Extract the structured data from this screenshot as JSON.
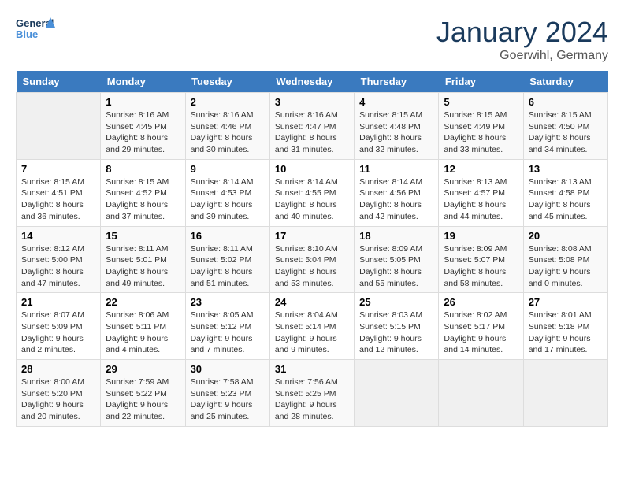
{
  "header": {
    "logo_line1": "General",
    "logo_line2": "Blue",
    "title": "January 2024",
    "subtitle": "Goerwihl, Germany"
  },
  "calendar": {
    "headers": [
      "Sunday",
      "Monday",
      "Tuesday",
      "Wednesday",
      "Thursday",
      "Friday",
      "Saturday"
    ],
    "weeks": [
      [
        {
          "day": "",
          "sunrise": "",
          "sunset": "",
          "daylight": "",
          "empty": true
        },
        {
          "day": "1",
          "sunrise": "Sunrise: 8:16 AM",
          "sunset": "Sunset: 4:45 PM",
          "daylight": "Daylight: 8 hours and 29 minutes."
        },
        {
          "day": "2",
          "sunrise": "Sunrise: 8:16 AM",
          "sunset": "Sunset: 4:46 PM",
          "daylight": "Daylight: 8 hours and 30 minutes."
        },
        {
          "day": "3",
          "sunrise": "Sunrise: 8:16 AM",
          "sunset": "Sunset: 4:47 PM",
          "daylight": "Daylight: 8 hours and 31 minutes."
        },
        {
          "day": "4",
          "sunrise": "Sunrise: 8:15 AM",
          "sunset": "Sunset: 4:48 PM",
          "daylight": "Daylight: 8 hours and 32 minutes."
        },
        {
          "day": "5",
          "sunrise": "Sunrise: 8:15 AM",
          "sunset": "Sunset: 4:49 PM",
          "daylight": "Daylight: 8 hours and 33 minutes."
        },
        {
          "day": "6",
          "sunrise": "Sunrise: 8:15 AM",
          "sunset": "Sunset: 4:50 PM",
          "daylight": "Daylight: 8 hours and 34 minutes."
        }
      ],
      [
        {
          "day": "7",
          "sunrise": "Sunrise: 8:15 AM",
          "sunset": "Sunset: 4:51 PM",
          "daylight": "Daylight: 8 hours and 36 minutes."
        },
        {
          "day": "8",
          "sunrise": "Sunrise: 8:15 AM",
          "sunset": "Sunset: 4:52 PM",
          "daylight": "Daylight: 8 hours and 37 minutes."
        },
        {
          "day": "9",
          "sunrise": "Sunrise: 8:14 AM",
          "sunset": "Sunset: 4:53 PM",
          "daylight": "Daylight: 8 hours and 39 minutes."
        },
        {
          "day": "10",
          "sunrise": "Sunrise: 8:14 AM",
          "sunset": "Sunset: 4:55 PM",
          "daylight": "Daylight: 8 hours and 40 minutes."
        },
        {
          "day": "11",
          "sunrise": "Sunrise: 8:14 AM",
          "sunset": "Sunset: 4:56 PM",
          "daylight": "Daylight: 8 hours and 42 minutes."
        },
        {
          "day": "12",
          "sunrise": "Sunrise: 8:13 AM",
          "sunset": "Sunset: 4:57 PM",
          "daylight": "Daylight: 8 hours and 44 minutes."
        },
        {
          "day": "13",
          "sunrise": "Sunrise: 8:13 AM",
          "sunset": "Sunset: 4:58 PM",
          "daylight": "Daylight: 8 hours and 45 minutes."
        }
      ],
      [
        {
          "day": "14",
          "sunrise": "Sunrise: 8:12 AM",
          "sunset": "Sunset: 5:00 PM",
          "daylight": "Daylight: 8 hours and 47 minutes."
        },
        {
          "day": "15",
          "sunrise": "Sunrise: 8:11 AM",
          "sunset": "Sunset: 5:01 PM",
          "daylight": "Daylight: 8 hours and 49 minutes."
        },
        {
          "day": "16",
          "sunrise": "Sunrise: 8:11 AM",
          "sunset": "Sunset: 5:02 PM",
          "daylight": "Daylight: 8 hours and 51 minutes."
        },
        {
          "day": "17",
          "sunrise": "Sunrise: 8:10 AM",
          "sunset": "Sunset: 5:04 PM",
          "daylight": "Daylight: 8 hours and 53 minutes."
        },
        {
          "day": "18",
          "sunrise": "Sunrise: 8:09 AM",
          "sunset": "Sunset: 5:05 PM",
          "daylight": "Daylight: 8 hours and 55 minutes."
        },
        {
          "day": "19",
          "sunrise": "Sunrise: 8:09 AM",
          "sunset": "Sunset: 5:07 PM",
          "daylight": "Daylight: 8 hours and 58 minutes."
        },
        {
          "day": "20",
          "sunrise": "Sunrise: 8:08 AM",
          "sunset": "Sunset: 5:08 PM",
          "daylight": "Daylight: 9 hours and 0 minutes."
        }
      ],
      [
        {
          "day": "21",
          "sunrise": "Sunrise: 8:07 AM",
          "sunset": "Sunset: 5:09 PM",
          "daylight": "Daylight: 9 hours and 2 minutes."
        },
        {
          "day": "22",
          "sunrise": "Sunrise: 8:06 AM",
          "sunset": "Sunset: 5:11 PM",
          "daylight": "Daylight: 9 hours and 4 minutes."
        },
        {
          "day": "23",
          "sunrise": "Sunrise: 8:05 AM",
          "sunset": "Sunset: 5:12 PM",
          "daylight": "Daylight: 9 hours and 7 minutes."
        },
        {
          "day": "24",
          "sunrise": "Sunrise: 8:04 AM",
          "sunset": "Sunset: 5:14 PM",
          "daylight": "Daylight: 9 hours and 9 minutes."
        },
        {
          "day": "25",
          "sunrise": "Sunrise: 8:03 AM",
          "sunset": "Sunset: 5:15 PM",
          "daylight": "Daylight: 9 hours and 12 minutes."
        },
        {
          "day": "26",
          "sunrise": "Sunrise: 8:02 AM",
          "sunset": "Sunset: 5:17 PM",
          "daylight": "Daylight: 9 hours and 14 minutes."
        },
        {
          "day": "27",
          "sunrise": "Sunrise: 8:01 AM",
          "sunset": "Sunset: 5:18 PM",
          "daylight": "Daylight: 9 hours and 17 minutes."
        }
      ],
      [
        {
          "day": "28",
          "sunrise": "Sunrise: 8:00 AM",
          "sunset": "Sunset: 5:20 PM",
          "daylight": "Daylight: 9 hours and 20 minutes."
        },
        {
          "day": "29",
          "sunrise": "Sunrise: 7:59 AM",
          "sunset": "Sunset: 5:22 PM",
          "daylight": "Daylight: 9 hours and 22 minutes."
        },
        {
          "day": "30",
          "sunrise": "Sunrise: 7:58 AM",
          "sunset": "Sunset: 5:23 PM",
          "daylight": "Daylight: 9 hours and 25 minutes."
        },
        {
          "day": "31",
          "sunrise": "Sunrise: 7:56 AM",
          "sunset": "Sunset: 5:25 PM",
          "daylight": "Daylight: 9 hours and 28 minutes."
        },
        {
          "day": "",
          "sunrise": "",
          "sunset": "",
          "daylight": "",
          "empty": true
        },
        {
          "day": "",
          "sunrise": "",
          "sunset": "",
          "daylight": "",
          "empty": true
        },
        {
          "day": "",
          "sunrise": "",
          "sunset": "",
          "daylight": "",
          "empty": true
        }
      ]
    ]
  }
}
